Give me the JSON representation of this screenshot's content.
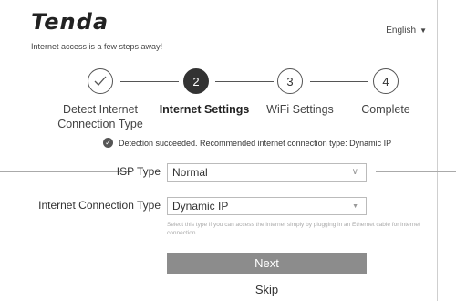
{
  "header": {
    "logo": "Tenda",
    "tagline": "Internet access is a few steps away!",
    "language": "English"
  },
  "steps": [
    {
      "marker": "",
      "label": "Detect Internet Connection Type",
      "state": "done"
    },
    {
      "marker": "2",
      "label": "Internet Settings",
      "state": "active"
    },
    {
      "marker": "3",
      "label": "WiFi Settings",
      "state": "pending"
    },
    {
      "marker": "4",
      "label": "Complete",
      "state": "pending"
    }
  ],
  "status": {
    "text": "Detection succeeded. Recommended internet connection type: Dynamic IP"
  },
  "form": {
    "isp_label": "ISP Type",
    "isp_value": "Normal",
    "conn_label": "Internet Connection Type",
    "conn_value": "Dynamic IP",
    "hint": "Select this type if you can access the internet simply by plugging in an Ethernet cable for internet connection."
  },
  "actions": {
    "next": "Next",
    "skip": "Skip"
  },
  "colors": {
    "active_step": "#333333",
    "button": "#8c8c8c"
  }
}
